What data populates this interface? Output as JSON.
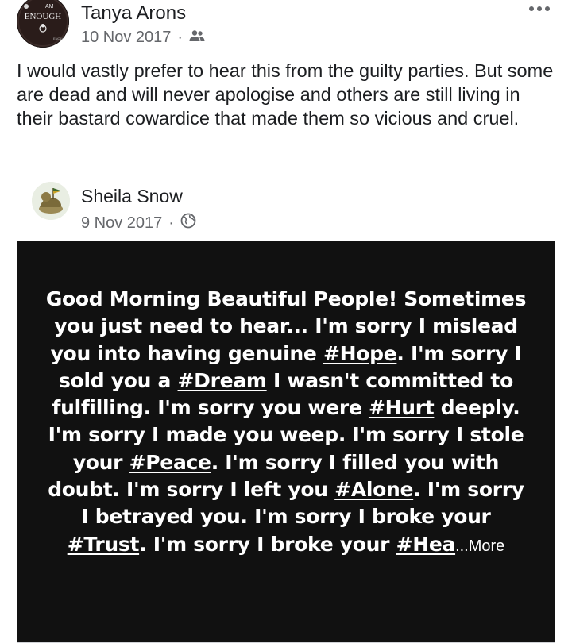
{
  "post": {
    "author": "Tanya Arons",
    "date": "10 Nov 2017",
    "separator": "·",
    "audience_icon": "friends-icon",
    "avatar_text": "ENOUGH",
    "body": "I would vastly prefer to hear this from the guilty parties. But some are dead and will never apologise and others are still living in their bastard cowardice that made them so vicious and cruel."
  },
  "shared": {
    "author": "Sheila Snow",
    "date": "9 Nov 2017",
    "separator": "·",
    "audience_icon": "globe-icon",
    "quote": {
      "segments": [
        {
          "text": "Good Morning Beautiful People! Sometimes you just need to hear... I'm sorry I mislead you into having genuine "
        },
        {
          "text": "#Hope",
          "tag": true
        },
        {
          "text": ". I'm sorry I sold you a "
        },
        {
          "text": "#Dream",
          "tag": true
        },
        {
          "text": " I wasn't committed to fulfilling. I'm sorry you were "
        },
        {
          "text": "#Hurt",
          "tag": true
        },
        {
          "text": " deeply. I'm sorry I made you weep. I'm sorry I stole your "
        },
        {
          "text": "#Peace",
          "tag": true
        },
        {
          "text": ". I'm sorry I filled you with doubt. I'm sorry I left you "
        },
        {
          "text": "#Alone",
          "tag": true
        },
        {
          "text": ". I'm sorry I betrayed you. I'm sorry I broke your "
        },
        {
          "text": "#Trust",
          "tag": true
        },
        {
          "text": ". I'm sorry I broke your "
        },
        {
          "text": "#Hea",
          "tag": true
        }
      ],
      "more_label": "...More"
    }
  },
  "colors": {
    "panel": "#111111",
    "text": "#1c1e21",
    "meta": "#65676b"
  }
}
